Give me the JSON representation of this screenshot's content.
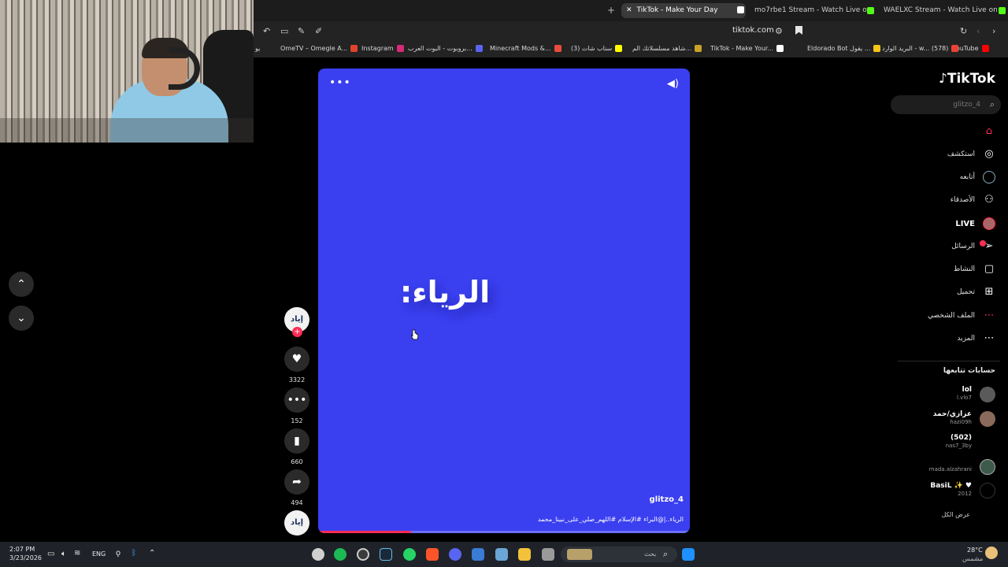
{
  "browser": {
    "tabs": [
      {
        "label": "TikTok - Make Your Day",
        "close": "✕",
        "active": true
      },
      {
        "label": "mo7rbe1 Stream - Watch Live on Kick",
        "active": false
      },
      {
        "label": "WAELXC Stream - Watch Live on Kick",
        "active": false
      }
    ],
    "new_tab": "+",
    "url": "tiktok.com",
    "bookmarks": [
      "YouTube",
      "البريد الوارد - w... (578)",
      "Eldorado Bot يقول ...",
      "TikTok - Make Your...",
      "شاهد مسلسلاتك الم...",
      "سناب شات (3)",
      "Minecraft Mods &...",
      "بروبوت - البوت العرب...",
      "Instagram",
      "OmeTV – Omegle A...",
      "يو"
    ]
  },
  "video": {
    "overlay_text": "الرياء:",
    "author": "glitzo_4",
    "description": "الرياء..|@البراء #الإسلام #اللهم_صلي_على_نبينا_محمد",
    "more_icon": "•••",
    "progress": 0.25
  },
  "actions": {
    "creator_avatar_text": "إياد",
    "likes": "3322",
    "comments": "152",
    "saves": "660",
    "shares": "494",
    "music_avatar_text": "إياد"
  },
  "sidebar": {
    "logo": "TikTok",
    "search_placeholder": "glitzo_4",
    "nav": [
      {
        "label": "",
        "icon": "home-icon"
      },
      {
        "label": "استكشف",
        "icon": "compass-icon"
      },
      {
        "label": "أتابعه",
        "icon": "following-icon"
      },
      {
        "label": "الأصدقاء",
        "icon": "friends-icon"
      },
      {
        "label": "LIVE",
        "icon": "live-icon"
      },
      {
        "label": "الرسائل",
        "icon": "messages-icon"
      },
      {
        "label": "النشاط",
        "icon": "activity-icon"
      },
      {
        "label": "تحميل",
        "icon": "upload-icon"
      },
      {
        "label": "الملف الشخصي",
        "icon": "profile-icon"
      },
      {
        "label": "المزيد",
        "icon": "more-icon"
      }
    ],
    "following_title": "حسابات تتابعها",
    "accounts": [
      {
        "name": "lol",
        "handle": "l.vlo7"
      },
      {
        "name": "عزازي/حمد",
        "handle": "hazi09h"
      },
      {
        "name": "(502)",
        "handle": "nas7_3by"
      },
      {
        "name": "",
        "handle": "mada.alzahrani"
      },
      {
        "name": "BasiL ✨ ♥",
        "handle": "2012"
      }
    ],
    "see_all": "عرض الكل"
  },
  "taskbar": {
    "time": "2:07 PM",
    "date": "3/23/2026",
    "lang": "ENG",
    "search_placeholder": "بحث",
    "weather_temp": "28°C",
    "weather_desc": "مشمس"
  },
  "colors": {
    "video_bg": "#3a3ff0",
    "accent": "#fe2c55",
    "page_bg": "#000000"
  }
}
